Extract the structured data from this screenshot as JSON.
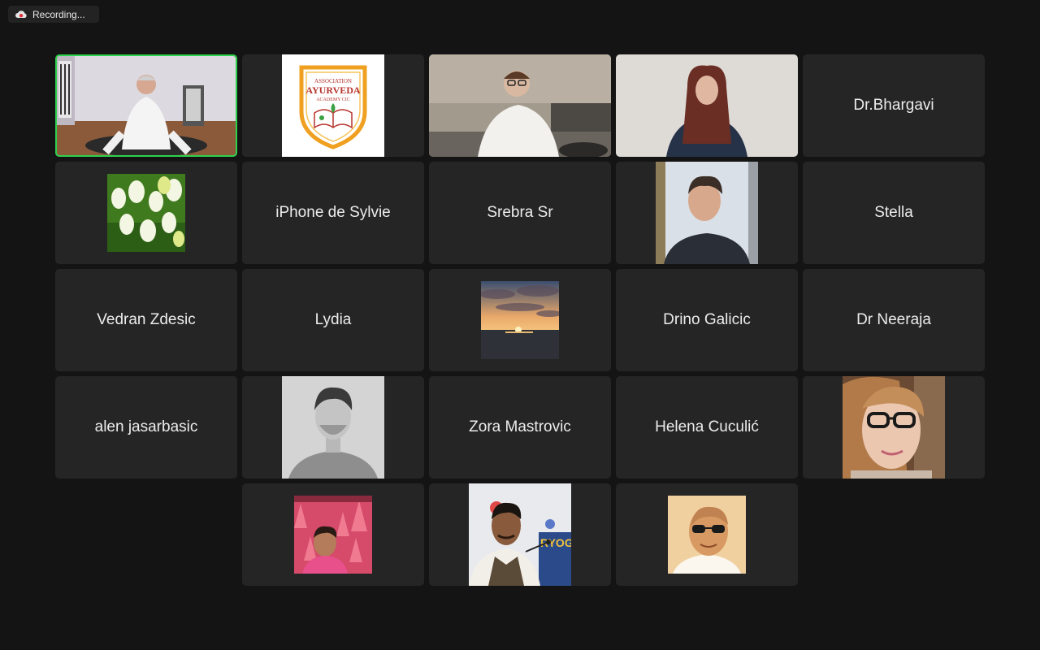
{
  "recording": {
    "label": "Recording..."
  },
  "participants": [
    {
      "name": "",
      "kind": "video",
      "scene": "instructor",
      "active": true
    },
    {
      "name": "",
      "kind": "logo",
      "scene": "ayurveda-logo",
      "logo_text": {
        "top": "ASSOCIATION",
        "middle": "AYURVEDA",
        "bottom": "ACADEMY CIC"
      }
    },
    {
      "name": "",
      "kind": "video",
      "scene": "man-glasses"
    },
    {
      "name": "",
      "kind": "video",
      "scene": "woman-redhair"
    },
    {
      "name": "Dr.Bhargavi",
      "kind": "name"
    },
    {
      "name": "",
      "kind": "avatar",
      "scene": "tulips"
    },
    {
      "name": "iPhone de Sylvie",
      "kind": "name"
    },
    {
      "name": "Srebra Sr",
      "kind": "name"
    },
    {
      "name": "",
      "kind": "video",
      "scene": "man-portrait"
    },
    {
      "name": "Stella",
      "kind": "name"
    },
    {
      "name": "Vedran Zdesic",
      "kind": "name"
    },
    {
      "name": "Lydia",
      "kind": "name"
    },
    {
      "name": "",
      "kind": "avatar",
      "scene": "sunset"
    },
    {
      "name": "Drino Galicic",
      "kind": "name"
    },
    {
      "name": "Dr Neeraja",
      "kind": "name"
    },
    {
      "name": "alen jasarbasic",
      "kind": "name"
    },
    {
      "name": "",
      "kind": "avatar",
      "scene": "bw-man"
    },
    {
      "name": "Zora Mastrovic",
      "kind": "name"
    },
    {
      "name": "Helena Cuculić",
      "kind": "name"
    },
    {
      "name": "",
      "kind": "avatar",
      "scene": "woman-glasses"
    },
    {
      "name": "",
      "kind": "avatar",
      "scene": "woman-pink"
    },
    {
      "name": "",
      "kind": "avatar",
      "scene": "speaker",
      "banner_text": "RYOG"
    },
    {
      "name": "",
      "kind": "avatar",
      "scene": "man-sunglasses"
    }
  ],
  "colors": {
    "tile": "#252525",
    "active_border": "#2dd24c",
    "background": "#141414"
  }
}
